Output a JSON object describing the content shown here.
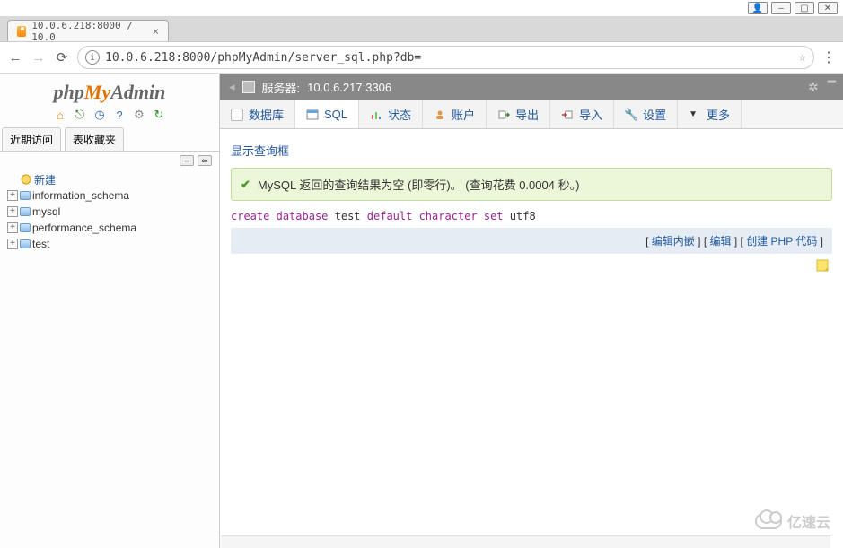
{
  "os": {
    "user_icon": "👤",
    "min": "–",
    "max": "▢",
    "close": "✕"
  },
  "browser": {
    "tab_title": "10.0.6.218:8000 / 10.0",
    "url": "10.0.6.218:8000/phpMyAdmin/server_sql.php?db="
  },
  "logo": {
    "a": "php",
    "b": "My",
    "c": "Admin"
  },
  "sidebar_tabs": {
    "recent": "近期访问",
    "fav": "表收藏夹"
  },
  "tree": {
    "new_label": "新建",
    "items": [
      {
        "label": "information_schema"
      },
      {
        "label": "mysql"
      },
      {
        "label": "performance_schema"
      },
      {
        "label": "test"
      }
    ]
  },
  "server": {
    "prefix": "服务器:",
    "host": "10.0.6.217:3306"
  },
  "topmenu": {
    "database": "数据库",
    "sql": "SQL",
    "status": "状态",
    "accounts": "账户",
    "export": "导出",
    "import": "导入",
    "settings": "设置",
    "more": "更多"
  },
  "content": {
    "show_query_box": "显示查询框",
    "ok_msg": "MySQL 返回的查询结果为空 (即零行)。 (查询花费 0.0004 秒。)",
    "sql": {
      "t1": "create",
      "t2": "database",
      "t3": "test",
      "t4": "default",
      "t5": "character",
      "t6": "set",
      "t7": "utf8"
    },
    "actions": {
      "lb": "[ ",
      "rb": " ]",
      "inline": "编辑内嵌",
      "edit": "编辑",
      "phpcode": "创建 PHP 代码"
    }
  },
  "watermark": "亿速云"
}
